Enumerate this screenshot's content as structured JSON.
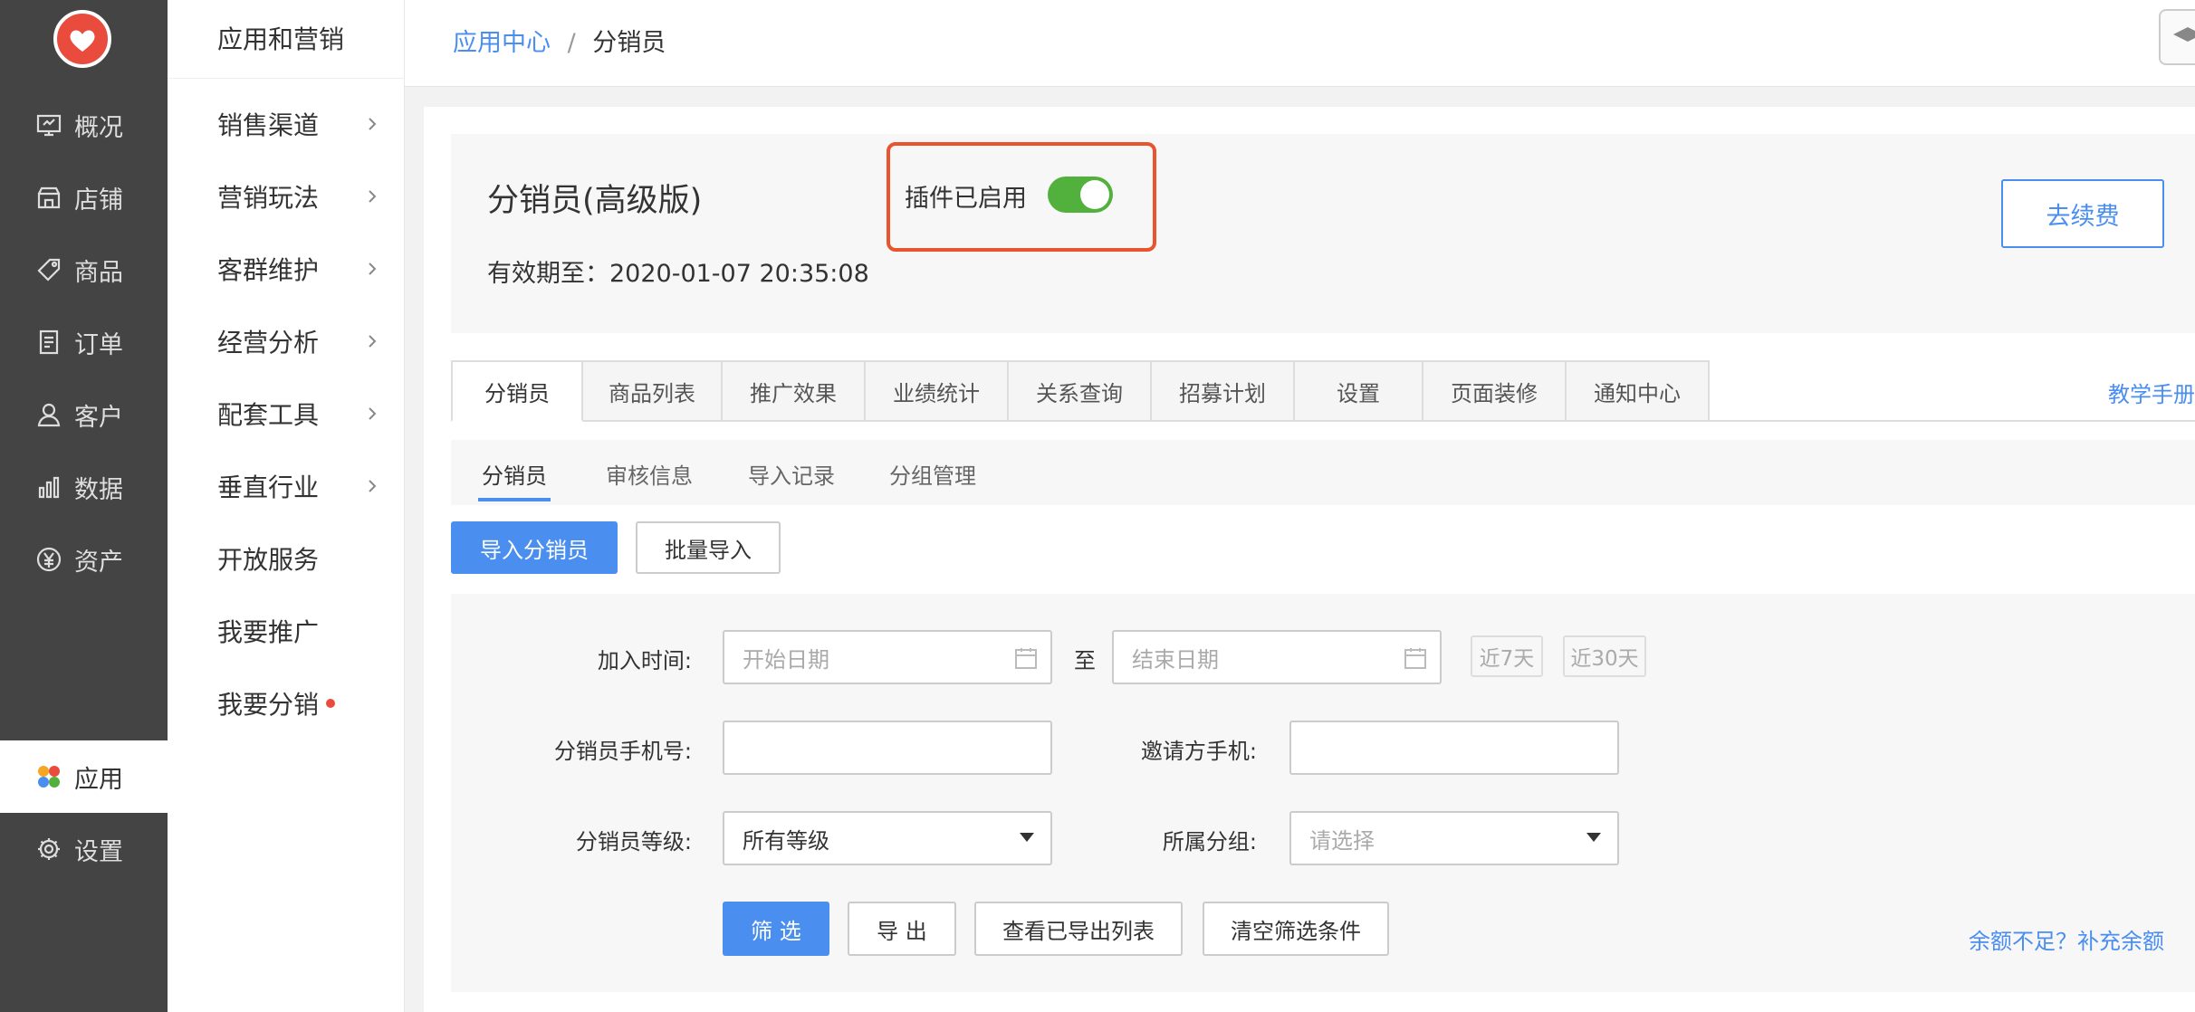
{
  "nav": {
    "items": [
      {
        "label": "概况",
        "icon": "monitor-icon"
      },
      {
        "label": "店铺",
        "icon": "store-icon"
      },
      {
        "label": "商品",
        "icon": "tag-icon"
      },
      {
        "label": "订单",
        "icon": "order-icon"
      },
      {
        "label": "客户",
        "icon": "user-icon"
      },
      {
        "label": "数据",
        "icon": "bar-chart-icon"
      },
      {
        "label": "资产",
        "icon": "yen-icon"
      },
      {
        "label": "应用",
        "icon": "apps-icon",
        "active": true
      },
      {
        "label": "设置",
        "icon": "gear-icon"
      }
    ]
  },
  "subnav": {
    "title": "应用和营销",
    "items": [
      {
        "label": "销售渠道"
      },
      {
        "label": "营销玩法"
      },
      {
        "label": "客群维护"
      },
      {
        "label": "经营分析"
      },
      {
        "label": "配套工具"
      },
      {
        "label": "垂直行业"
      },
      {
        "label": "开放服务"
      },
      {
        "label": "我要推广"
      },
      {
        "label": "我要分销"
      }
    ]
  },
  "breadcrumb": {
    "link": "应用中心",
    "sep": "/",
    "current": "分销员"
  },
  "plugin": {
    "title": "分销员(高级版)",
    "expire_label": "有效期至：",
    "expire_value": "2020-01-07 20:35:08",
    "status_text": "插件已启用",
    "enabled": true,
    "renew_label": "去续费"
  },
  "tabs": [
    "分销员",
    "商品列表",
    "推广效果",
    "业绩统计",
    "关系查询",
    "招募计划",
    "设置",
    "页面装修",
    "通知中心"
  ],
  "tab_help": "教学手册",
  "subtabs": [
    "分销员",
    "审核信息",
    "导入记录",
    "分组管理"
  ],
  "actions": {
    "import_label": "导入分销员",
    "batch_label": "批量导入"
  },
  "filter": {
    "join_time_label": "加入时间:",
    "start_placeholder": "开始日期",
    "to_label": "至",
    "end_placeholder": "结束日期",
    "quick_7": "近7天",
    "quick_30": "近30天",
    "phone_label": "分销员手机号:",
    "inviter_label": "邀请方手机:",
    "level_label": "分销员等级:",
    "level_value": "所有等级",
    "group_label": "所属分组:",
    "group_placeholder": "请选择",
    "filter_btn": "筛 选",
    "export_btn": "导 出",
    "view_export_btn": "查看已导出列表",
    "clear_btn": "清空筛选条件",
    "topup_link": "余额不足？补充余额"
  },
  "colors": {
    "accent": "#4a8ef0",
    "toggle": "#52b13c",
    "highlight": "#e8542e",
    "nav_bg": "#444444"
  }
}
